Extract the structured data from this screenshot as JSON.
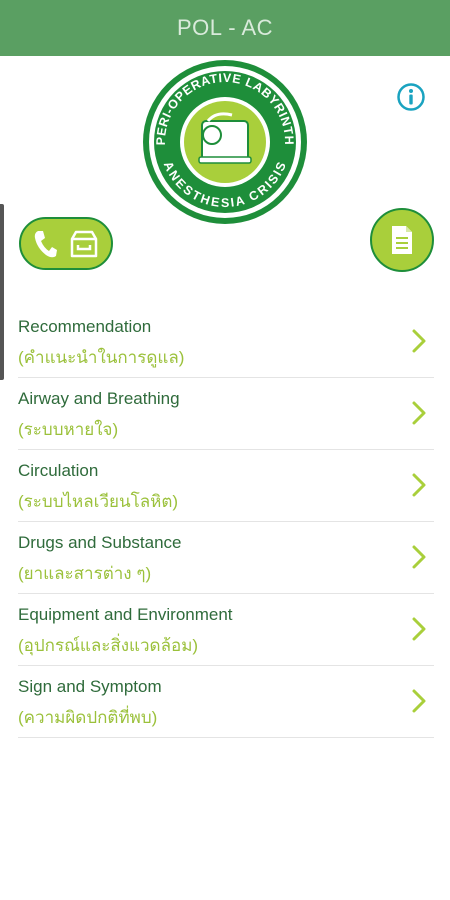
{
  "header": {
    "title": "POL - AC"
  },
  "logo": {
    "text_top": "PERI-OPERATIVE LABYRINTH",
    "text_bottom": "ANESTHESIA CRISIS"
  },
  "icons": {
    "info": "info-icon",
    "phone": "phone-icon",
    "archive": "archive-icon",
    "document": "document-icon",
    "chevron": "chevron-right-icon"
  },
  "colors": {
    "header": "#5a9f62",
    "accent_green": "#a9cf3b",
    "dark_green": "#1e8e3a",
    "title_text": "#2f6b3b",
    "subtitle_text": "#9bc13b",
    "info": "#1aa3c0"
  },
  "menu": {
    "items": [
      {
        "title": "Recommendation",
        "subtitle": "(คำแนะนำในการดูแล)"
      },
      {
        "title": "Airway and Breathing",
        "subtitle": "(ระบบหายใจ)"
      },
      {
        "title": "Circulation",
        "subtitle": "(ระบบไหลเวียนโลหิต)"
      },
      {
        "title": "Drugs and Substance",
        "subtitle": "(ยาและสารต่าง ๆ)"
      },
      {
        "title": "Equipment and Environment",
        "subtitle": "(อุปกรณ์และสิ่งแวดล้อม)"
      },
      {
        "title": "Sign and Symptom",
        "subtitle": "(ความผิดปกติที่พบ)"
      }
    ]
  }
}
